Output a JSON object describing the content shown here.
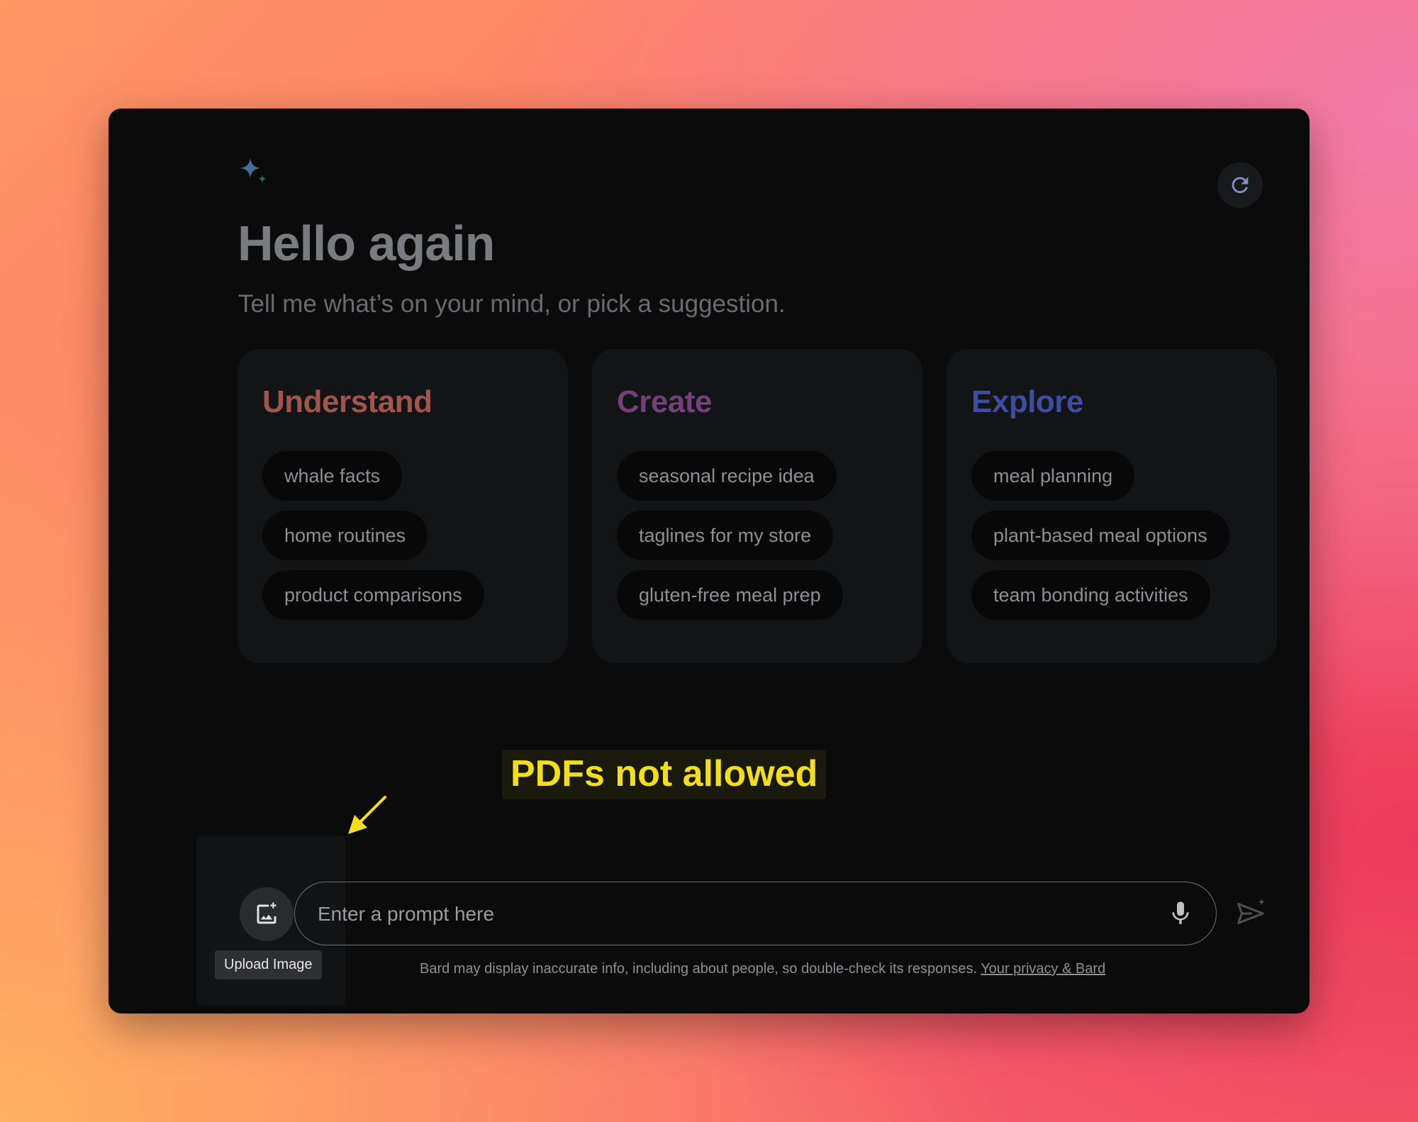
{
  "greeting": {
    "title": "Hello again",
    "subtitle": "Tell me what’s on your mind, or pick a suggestion."
  },
  "cards": [
    {
      "title": "Understand",
      "color": "#a0564b",
      "chips": [
        "whale facts",
        "home routines",
        "product comparisons"
      ]
    },
    {
      "title": "Create",
      "color": "#73407a",
      "chips": [
        "seasonal recipe idea",
        "taglines for my store",
        "gluten-free meal prep"
      ]
    },
    {
      "title": "Explore",
      "color": "#3f4da0",
      "chips": [
        "meal planning",
        "plant-based meal options",
        "team bonding activities"
      ]
    }
  ],
  "annotation": {
    "text": "PDFs not allowed",
    "color": "#f4de1b"
  },
  "upload": {
    "tooltip": "Upload Image",
    "icon": "add-photo-icon"
  },
  "prompt": {
    "placeholder": "Enter a prompt here",
    "mic_icon": "mic-icon",
    "send_icon": "send-icon"
  },
  "footer": {
    "disclaimer": "Bard may display inaccurate info, including about people, so double-check its responses.",
    "link": "Your privacy & Bard"
  },
  "header": {
    "logo_icon": "sparkle-icon",
    "refresh_icon": "refresh-icon"
  }
}
